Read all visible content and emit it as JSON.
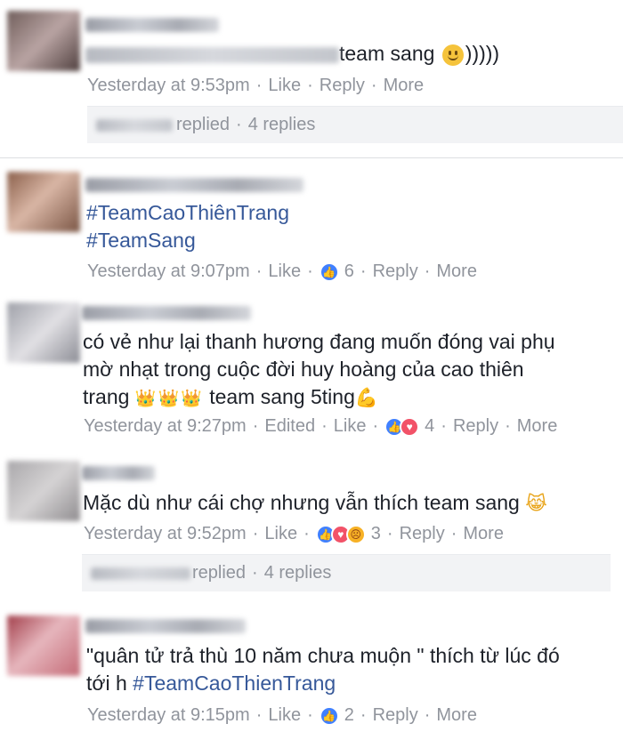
{
  "colors": {
    "meta_gray": "#90949c",
    "link_blue": "#365899",
    "like_blue": "#4080ff",
    "love_red": "#f25268",
    "angry_yellow": "#f7b125",
    "reply_bg": "#f2f3f5"
  },
  "comments": [
    {
      "text": "team sang",
      "text_suffix": ")))))",
      "emoji_icon": "slightly-smiling-face-icon",
      "time": "Yesterday at 9:53pm",
      "like": "Like",
      "reply": "Reply",
      "more": "More",
      "replies_label": "replied",
      "replies_count": "4 replies"
    },
    {
      "line1": "#TeamCaoThiênTrang",
      "line2": "#TeamSang",
      "time": "Yesterday at 9:07pm",
      "like": "Like",
      "reactions": [
        "like-reaction-icon"
      ],
      "reaction_count": "6",
      "reply": "Reply",
      "more": "More"
    },
    {
      "line1": "có vẻ như lại thanh hương đang muốn đóng vai phụ",
      "line2": "mờ nhạt trong cuộc đời huy hoàng của cao thiên",
      "line3": "trang",
      "crowns": "👑👑👑",
      "line3_tail": "team sang 5ting",
      "muscle": "💪",
      "time": "Yesterday at 9:27pm",
      "edited": "Edited",
      "like": "Like",
      "reactions": [
        "like-reaction-icon",
        "love-reaction-icon"
      ],
      "reaction_count": "4",
      "reply": "Reply",
      "more": "More"
    },
    {
      "line1": "Mặc dù như cái chợ nhưng vẫn thích team sang",
      "emoji": "😹",
      "time": "Yesterday at 9:52pm",
      "like": "Like",
      "reactions": [
        "like-reaction-icon",
        "love-reaction-icon",
        "angry-reaction-icon"
      ],
      "reaction_count": "3",
      "reply": "Reply",
      "more": "More",
      "replies_label": "replied",
      "replies_count": "4 replies"
    },
    {
      "line1": "\"quân tử trả thù 10 năm chưa muộn \" thích từ lúc đó",
      "line2_plain": "tới h",
      "line2_tag": "#TeamCaoThienTrang",
      "time": "Yesterday at 9:15pm",
      "like": "Like",
      "reactions": [
        "like-reaction-icon"
      ],
      "reaction_count": "2",
      "reply": "Reply",
      "more": "More"
    }
  ]
}
